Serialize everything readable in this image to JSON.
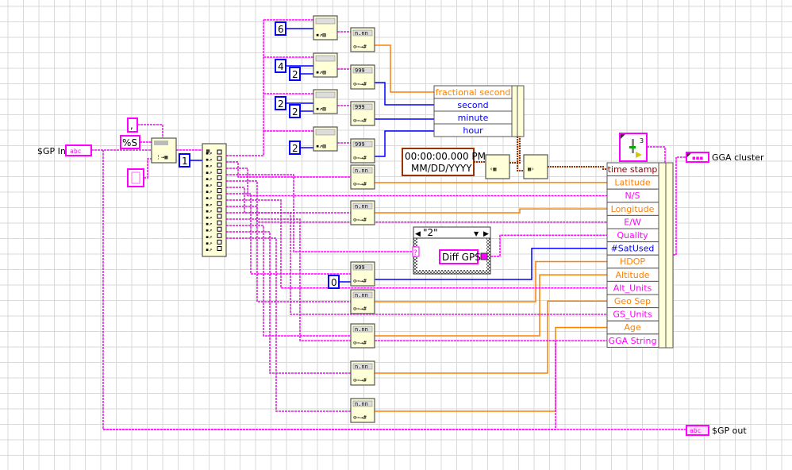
{
  "colors": {
    "string": "#ff00ff",
    "double": "#ff8000",
    "integer": "#0000ff",
    "timestamp": "#993300",
    "node": "#ffffd8",
    "grid": "#d9d9d9"
  },
  "terminals": {
    "sgp_in": {
      "label": "$GP In",
      "glyph": "abc"
    },
    "sgp_out": {
      "label": "$GP out",
      "glyph": "abc"
    },
    "gga_cluster": {
      "label": "GGA cluster"
    }
  },
  "constants": {
    "delimiter": ",",
    "format": "%S",
    "index": "1",
    "substr_offset_1": "6",
    "substr_offset_2": "4",
    "substr_len_2": "2",
    "substr_offset_3": "2",
    "substr_len_3": "2",
    "substr_len_4": "2",
    "sat_default": "0",
    "cluster_const_count": "3"
  },
  "time_bundle": {
    "rows": [
      "fractional second",
      "second",
      "minute",
      "hour"
    ]
  },
  "timestamp_const": {
    "time": "00:00:00.000 PM",
    "date": "MM/DD/YYYY"
  },
  "case_structure": {
    "selector": "\"2\"",
    "value": "Diff GPS",
    "tunnel": "?"
  },
  "gga_bundle": {
    "rows": [
      "time stamp",
      "Latitude",
      "N/S",
      "Longitude",
      "E/W",
      "Quality",
      "#SatUsed",
      "HDOP",
      "Altitude",
      "Alt_Units",
      "Geo Sep",
      "GS_Units",
      "Age",
      "GGA String"
    ]
  },
  "icons": {
    "conversion_fract": "n.nn",
    "conversion_int": "999"
  }
}
